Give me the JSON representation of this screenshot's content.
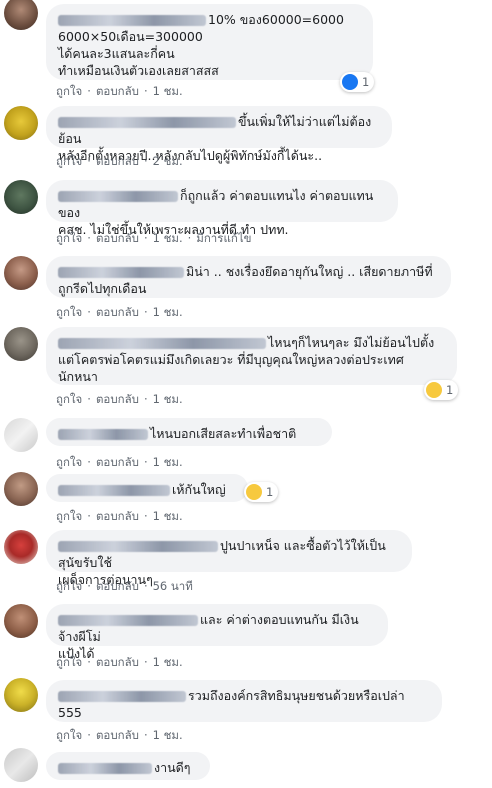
{
  "actions": {
    "like": "ถูกใจ",
    "reply": "ตอบกลับ",
    "edited": "มีการแก้ไข"
  },
  "comments": [
    {
      "text": "10% ของ60000=6000\n6000×50เดือน=300000\nได้คนละ3แสนละกี่คน\nทำเหมือนเงินตัวเองเลยสาสสส",
      "time": "1 ชม.",
      "reaction": {
        "icon": "like-icon",
        "count": "1"
      }
    },
    {
      "text": "ขึ้นเพิ่มให้ไม่ว่าแต่ไม่ต้องย้อน\nหลังอีกตั้งหลายปี..หลังกลับไปดูผู้พิทักษ์มังกี้ได้นะ..",
      "time": "2 ชม."
    },
    {
      "text": "ก็ถูกแล้ว ค่าตอบแทนไง ค่าตอบแทนของ\nคสช. ไม่ใช่ขึ้นให้เพราะผลงานที่ดี ทำ ปทท.",
      "time": "1 ชม."
    },
    {
      "text": "มิน่า .. ชงเรื่องยึดอายุกันใหญ่ .. เสียดายภาษีที่\nถูกรีดไปทุกเดือน",
      "time": "1 ชม."
    },
    {
      "text": "ไหนๆก็ไหนๆละ มึงไม่ย้อนไปตั้ง\nแต่โคตรพ่อโคตรแม่มึงเกิดเลยวะ ที่มีบุญคุณใหญ่หลวงต่อประเทศ\nนักหนา",
      "time": "1 ชม.",
      "reaction": {
        "icon": "haha-icon",
        "count": "1"
      }
    },
    {
      "text": "ไหนบอกเสียสละทำเพื่อชาติ",
      "time": "1 ชม."
    },
    {
      "text": "เห้กันใหญ่",
      "time": "1 ชม.",
      "reaction": {
        "icon": "haha-icon",
        "count": "1"
      }
    },
    {
      "text": "ปูนปาเหน็จ และซื้อตัวไว้ให้เป็นสุนัขรับใช้\nเผด็จการต่อนานๆ",
      "time": "56 นาที"
    },
    {
      "text": "และ ค่าต่างตอบแทนกัน มีเงินจ้างผีโม่\nแป้งได้",
      "time": "1 ชม."
    },
    {
      "text": "รวมถึงองค์กรสิทธิมนุษยชนด้วยหรือเปล่า\n555",
      "time": "1 ชม."
    },
    {
      "text": "งานดีๆ",
      "time": ""
    }
  ]
}
